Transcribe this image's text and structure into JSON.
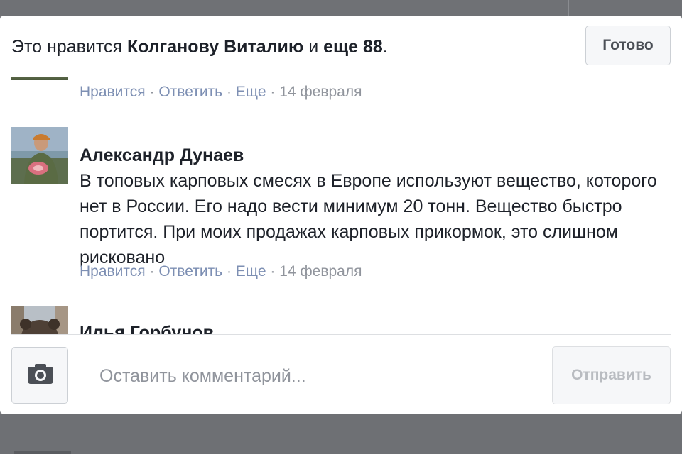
{
  "header": {
    "likes_prefix": "Это нравится ",
    "likes_name": "Колганову Виталию",
    "likes_middle": " и ",
    "likes_count": "еще 88",
    "likes_suffix": ".",
    "done_label": "Готово"
  },
  "comments": [
    {
      "actions": {
        "like": "Нравится",
        "reply": "Ответить",
        "more": "Еще",
        "date": "14 февраля"
      }
    },
    {
      "author": "Александр Дунаев",
      "text": "В топовых карповых смесях в Европе используют вещество, которого нет в России. Его надо вести минимум 20 тонн. Вещество быстро портится. При моих продажах карповых прикормок, это слишном рисковано",
      "actions": {
        "like": "Нравится",
        "reply": "Ответить",
        "more": "Еще",
        "date": "14 февраля"
      }
    },
    {
      "author": "Илья Горбунов"
    }
  ],
  "composer": {
    "placeholder": "Оставить комментарий...",
    "send_label": "Отправить",
    "camera_icon": "camera-icon"
  },
  "separator": " · "
}
